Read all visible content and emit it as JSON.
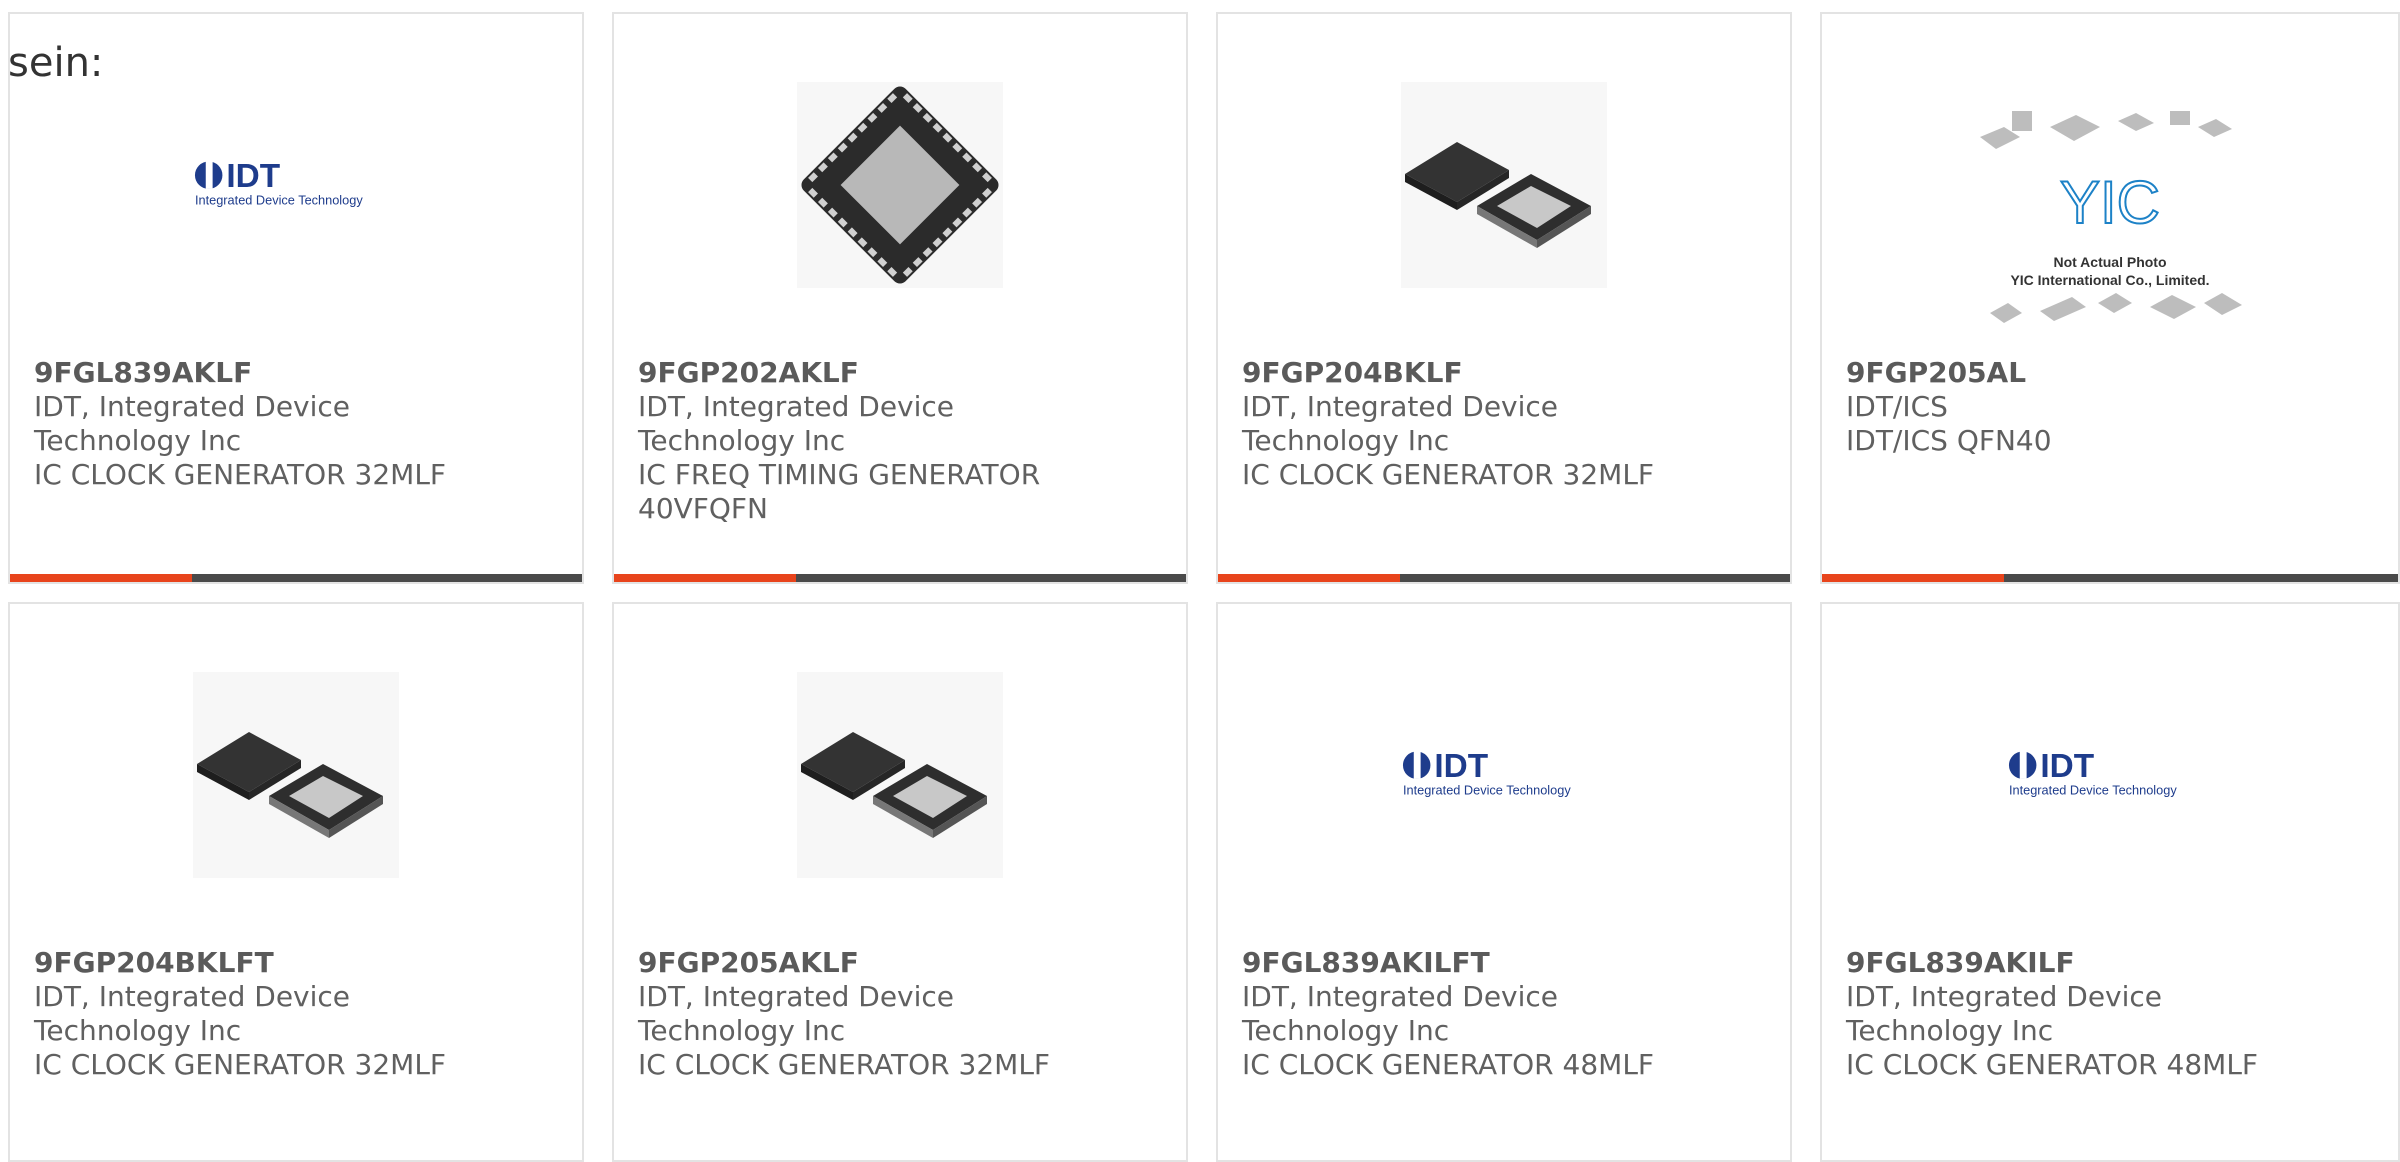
{
  "lead_text": "sein:",
  "brand_accent": "#e8441c",
  "products": [
    {
      "part": "9FGL839AKLF",
      "maker_line1": "IDT, Integrated Device",
      "maker_line2": "Technology Inc",
      "desc": "IC CLOCK GENERATOR 32MLF",
      "image": "idt-logo"
    },
    {
      "part": "9FGP202AKLF",
      "maker_line1": "IDT, Integrated Device",
      "maker_line2": "Technology Inc",
      "desc": "IC FREQ TIMING GENERATOR 40VFQFN",
      "image": "qfn-chip-single"
    },
    {
      "part": "9FGP204BKLF",
      "maker_line1": "IDT, Integrated Device",
      "maker_line2": "Technology Inc",
      "desc": "IC CLOCK GENERATOR 32MLF",
      "image": "qfn-chip-pair"
    },
    {
      "part": "9FGP205AL",
      "maker_line1": "IDT/ICS",
      "maker_line2": "IDT/ICS QFN40",
      "desc": "",
      "image": "yic-placeholder",
      "placeholder_line1": "Not Actual Photo",
      "placeholder_line2": "YIC International Co., Limited."
    },
    {
      "part": "9FGP204BKLFT",
      "maker_line1": "IDT, Integrated Device",
      "maker_line2": "Technology Inc",
      "desc": "IC CLOCK GENERATOR 32MLF",
      "image": "qfn-chip-pair"
    },
    {
      "part": "9FGP205AKLF",
      "maker_line1": "IDT, Integrated Device",
      "maker_line2": "Technology Inc",
      "desc": "IC CLOCK GENERATOR 32MLF",
      "image": "qfn-chip-pair"
    },
    {
      "part": "9FGL839AKILFT",
      "maker_line1": "IDT, Integrated Device",
      "maker_line2": "Technology Inc",
      "desc": "IC CLOCK GENERATOR 48MLF",
      "image": "idt-logo"
    },
    {
      "part": "9FGL839AKILF",
      "maker_line1": "IDT, Integrated Device",
      "maker_line2": "Technology Inc",
      "desc": "IC CLOCK GENERATOR 48MLF",
      "image": "idt-logo"
    }
  ],
  "idt_logo_text": "IDT",
  "idt_logo_tagline": "Integrated Device Technology"
}
